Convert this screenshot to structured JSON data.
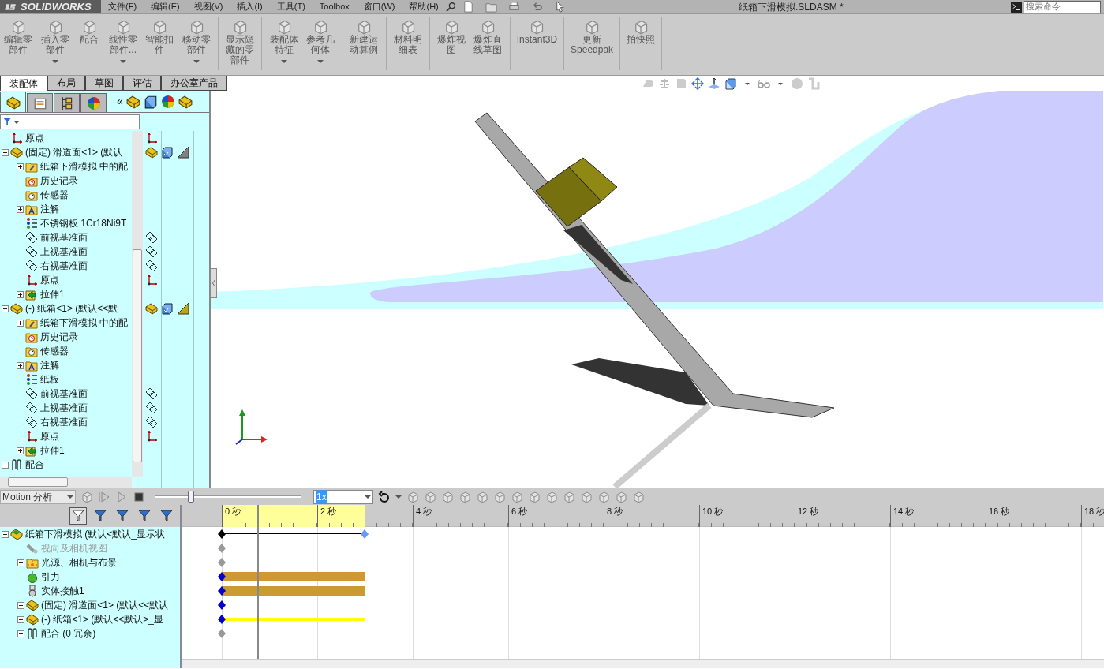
{
  "app": {
    "logo": "SOLIDWORKS",
    "menus": [
      "文件(F)",
      "编辑(E)",
      "视图(V)",
      "插入(I)",
      "工具(T)",
      "Toolbox",
      "窗口(W)",
      "帮助(H)"
    ],
    "document_title": "纸箱下滑模拟.SLDASM *",
    "search": {
      "placeholder": "搜索命令"
    }
  },
  "ribbon": [
    {
      "label": "编辑零部件",
      "menu": false,
      "group_end": false
    },
    {
      "label": "插入零部件",
      "menu": true,
      "group_end": false
    },
    {
      "label": "配合",
      "menu": false,
      "group_end": false
    },
    {
      "label": "线性零部件...",
      "menu": true,
      "group_end": false
    },
    {
      "label": "智能扣件",
      "menu": false,
      "group_end": false
    },
    {
      "label": "移动零部件",
      "menu": true,
      "group_end": true
    },
    {
      "label": "显示隐藏的零部件",
      "menu": false,
      "group_end": true
    },
    {
      "label": "装配体特征",
      "menu": true,
      "group_end": false
    },
    {
      "label": "参考几何体",
      "menu": true,
      "group_end": true
    },
    {
      "label": "新建运动算例",
      "menu": false,
      "group_end": true
    },
    {
      "label": "材料明细表",
      "menu": false,
      "group_end": true
    },
    {
      "label": "爆炸视图",
      "menu": false,
      "group_end": false
    },
    {
      "label": "爆炸直线草图",
      "menu": false,
      "group_end": true
    },
    {
      "label": "Instant3D",
      "menu": false,
      "group_end": true
    },
    {
      "label": "更新Speedpak",
      "menu": false,
      "group_end": true
    },
    {
      "label": "拍快照",
      "menu": false,
      "group_end": true
    }
  ],
  "tabs": [
    {
      "label": "装配体",
      "selected": true
    },
    {
      "label": "布局",
      "selected": false
    },
    {
      "label": "草图",
      "selected": false
    },
    {
      "label": "评估",
      "selected": false
    },
    {
      "label": "办公室产品",
      "selected": false
    }
  ],
  "feature_tree": {
    "tabs": [
      {
        "kind": "feature",
        "selected": true
      },
      {
        "kind": "property",
        "selected": false
      },
      {
        "kind": "config",
        "selected": false
      },
      {
        "kind": "display",
        "selected": false
      }
    ],
    "pane_toggle": "«",
    "items": [
      {
        "label": "原点",
        "kind": "origin"
      },
      {
        "label": "(固定) 滑道面<1> (默认",
        "kind": "component",
        "expanded": true,
        "color": "#808080",
        "children": [
          {
            "label": "纸箱下滑模拟 中的配",
            "kind": "matefolder",
            "expanded": false
          },
          {
            "label": "历史记录",
            "kind": "history"
          },
          {
            "label": "传感器",
            "kind": "sensor"
          },
          {
            "label": "注解",
            "kind": "annotation",
            "expanded": false
          },
          {
            "label": "不锈钢板 1Cr18Ni9T",
            "kind": "material"
          },
          {
            "label": "前视基准面",
            "kind": "plane"
          },
          {
            "label": "上视基准面",
            "kind": "plane"
          },
          {
            "label": "右视基准面",
            "kind": "plane"
          },
          {
            "label": "原点",
            "kind": "origin"
          },
          {
            "label": "拉伸1",
            "kind": "feature",
            "expanded": false
          }
        ]
      },
      {
        "label": "(-) 纸箱<1> (默认<<默",
        "kind": "component",
        "expanded": true,
        "color": "#b8a818",
        "children": [
          {
            "label": "纸箱下滑模拟 中的配",
            "kind": "matefolder",
            "expanded": false
          },
          {
            "label": "历史记录",
            "kind": "history"
          },
          {
            "label": "传感器",
            "kind": "sensor"
          },
          {
            "label": "注解",
            "kind": "annotation",
            "expanded": false
          },
          {
            "label": "纸板",
            "kind": "material"
          },
          {
            "label": "前视基准面",
            "kind": "plane"
          },
          {
            "label": "上视基准面",
            "kind": "plane"
          },
          {
            "label": "右视基准面",
            "kind": "plane"
          },
          {
            "label": "原点",
            "kind": "origin"
          },
          {
            "label": "拉伸1",
            "kind": "feature",
            "expanded": false
          }
        ]
      },
      {
        "label": "配合",
        "kind": "mates",
        "expanded": true
      }
    ]
  },
  "motion": {
    "study": "Motion 分析",
    "speed": "1x",
    "playback": {
      "level": 0.25
    },
    "ruler": [
      "0 秒",
      "2 秒",
      "4 秒",
      "6 秒",
      "8 秒",
      "10 秒",
      "12 秒",
      "14 秒",
      "16 秒",
      "18 秒"
    ],
    "items": [
      {
        "label": "纸箱下滑模拟 (默认<默认_显示状",
        "kind": "study",
        "expanded": true,
        "disabled": false,
        "track": {
          "kind": "span",
          "color": "#000000"
        },
        "children": [
          {
            "label": "视向及相机视图",
            "kind": "camera",
            "disabled": true,
            "track": {
              "kind": "key",
              "color": "#999999"
            }
          },
          {
            "label": "光源、相机与布景",
            "kind": "lights",
            "expanded": false,
            "disabled": false,
            "track": {
              "kind": "key",
              "color": "#999999"
            }
          },
          {
            "label": "引力",
            "kind": "gravity",
            "disabled": false,
            "track": {
              "kind": "bar",
              "color": "#0000cc"
            }
          },
          {
            "label": "实体接触1",
            "kind": "contact",
            "disabled": false,
            "track": {
              "kind": "bar",
              "color": "#0000cc"
            }
          },
          {
            "label": "(固定) 滑道面<1> (默认<<默认",
            "kind": "component",
            "expanded": false,
            "disabled": false,
            "track": {
              "kind": "key",
              "color": "#0000cc"
            }
          },
          {
            "label": "(-) 纸箱<1> (默认<<默认>_显",
            "kind": "component",
            "expanded": false,
            "disabled": false,
            "track": {
              "kind": "line",
              "color": "#0000cc"
            }
          },
          {
            "label": "配合 (0 冗余)",
            "kind": "mates",
            "expanded": false,
            "disabled": false,
            "track": {
              "kind": "key",
              "color": "#999999"
            }
          }
        ]
      }
    ]
  }
}
